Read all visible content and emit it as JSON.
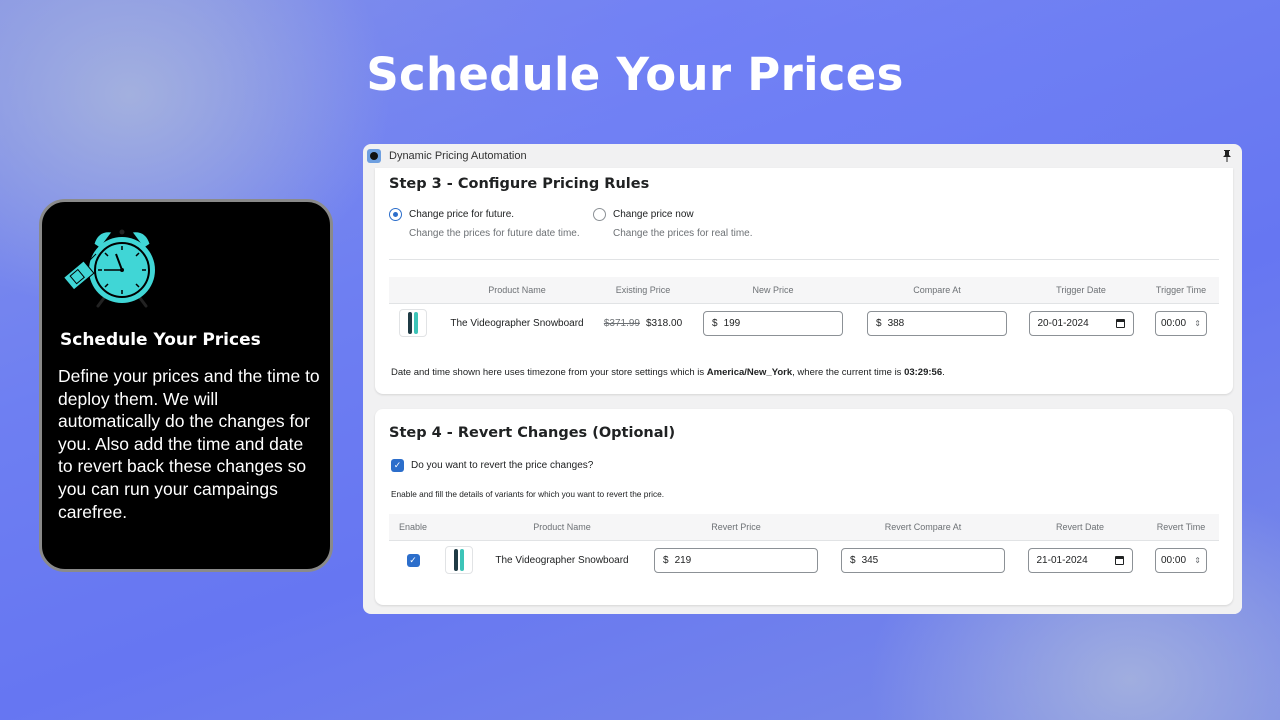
{
  "hero": {
    "title": "Schedule Your Prices"
  },
  "feature": {
    "icon": "alarm-clock-with-price-tag-icon",
    "title": "Schedule Your Prices",
    "description": "Define your prices and the time to deploy them. We will automatically do the changes for you. Also add the time and date to revert back these changes so you can run your campaings carefree."
  },
  "window": {
    "title": "Dynamic Pricing Automation",
    "pin_icon": "pin-icon"
  },
  "step3": {
    "title": "Step 3 - Configure Pricing Rules",
    "options": [
      {
        "label": "Change price for future.",
        "help": "Change the prices for future date time.",
        "selected": true
      },
      {
        "label": "Change price now",
        "help": "Change the prices for real time.",
        "selected": false
      }
    ],
    "columns": [
      "",
      "Product Name",
      "Existing Price",
      "New Price",
      "Compare At",
      "Trigger Date",
      "Trigger Time"
    ],
    "rows": [
      {
        "product": "The Videographer Snowboard",
        "existing_original": "$371.99",
        "existing_current": "$318.00",
        "currency": "$",
        "new_price": "199",
        "compare_at": "388",
        "trigger_date": "20-01-2024",
        "trigger_time": "00:00"
      }
    ],
    "timezone_note": {
      "prefix": "Date and time shown here uses timezone from your store settings which is ",
      "timezone": "America/New_York",
      "middle": ", where the current time is ",
      "time": "03:29:56",
      "suffix": "."
    }
  },
  "step4": {
    "title": "Step 4 - Revert Changes (Optional)",
    "revert_question": "Do you want to revert the price changes?",
    "revert_checked": true,
    "help": "Enable and fill the details of variants for which you want to revert the price.",
    "columns": [
      "Enable",
      "",
      "Product Name",
      "Revert Price",
      "Revert Compare At",
      "Revert Date",
      "Revert Time"
    ],
    "rows": [
      {
        "enabled": true,
        "product": "The Videographer Snowboard",
        "currency": "$",
        "revert_price": "219",
        "revert_compare_at": "345",
        "revert_date": "21-01-2024",
        "revert_time": "00:00"
      }
    ]
  },
  "colors": {
    "accent": "#2c6ecb",
    "icon_teal": "#40d6d6",
    "card_bg": "#000000"
  }
}
